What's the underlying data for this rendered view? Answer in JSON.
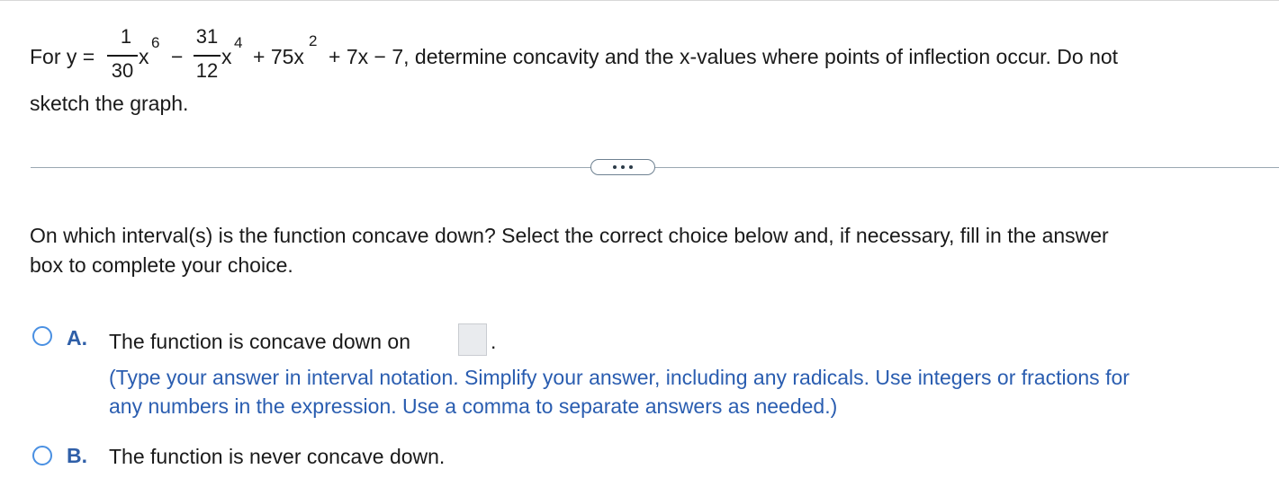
{
  "question": {
    "for_y": "For y =",
    "frac1_num": "1",
    "frac1_den": "30",
    "x1": "x",
    "exp1": "6",
    "minus": "−",
    "frac2_num": "31",
    "frac2_den": "12",
    "x2": "x",
    "exp2": "4",
    "plus_75x": "+ 75x",
    "exp3": "2",
    "rest": "+ 7x − 7, determine concavity and the x-values where points of inflection occur. Do not",
    "line2": "sketch the graph."
  },
  "subquestion": {
    "line1": "On which interval(s) is the function concave down? Select the correct choice below and, if necessary, fill in the answer",
    "line2": "box to complete your choice."
  },
  "choices": {
    "a": {
      "letter": "A.",
      "text": "The function is concave down on",
      "after_box": ".",
      "hint_line1": "(Type your answer in interval notation. Simplify your answer, including any radicals. Use integers or fractions for",
      "hint_line2": "any numbers in the expression. Use a comma to separate answers as needed.)"
    },
    "b": {
      "letter": "B.",
      "text": "The function is never concave down."
    }
  },
  "colors": {
    "radio_border": "#4a90e2",
    "choice_letter": "#2f5fa8",
    "hint_text": "#2a5db0"
  }
}
